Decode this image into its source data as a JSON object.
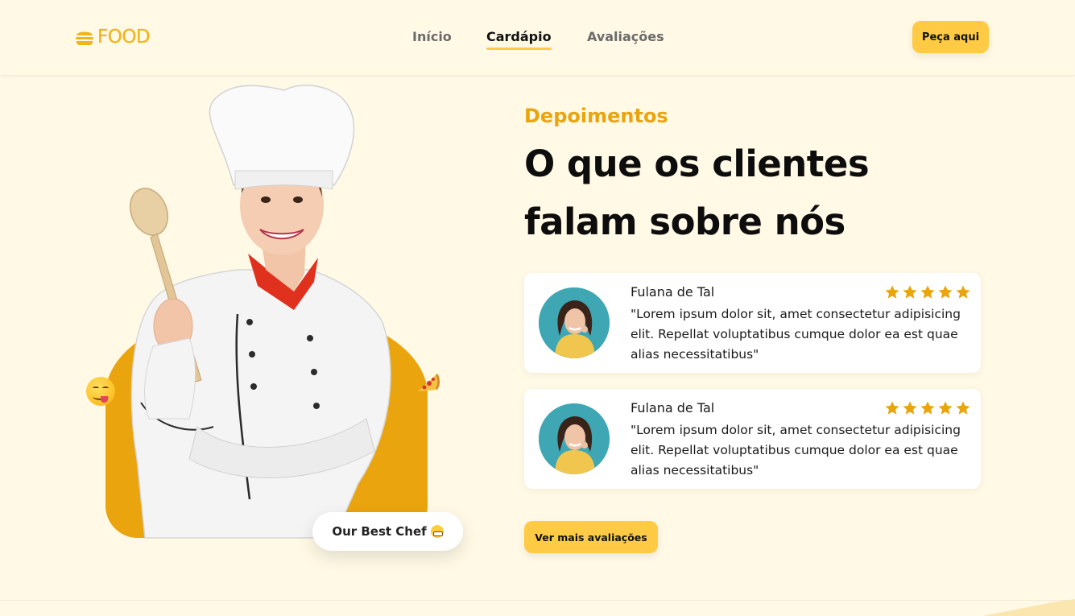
{
  "brand": {
    "logo_text": "FOOD",
    "accent": "#ffcb45",
    "accent_dark": "#eaa40d",
    "background": "#fff9e6"
  },
  "nav": {
    "items": [
      {
        "label": "Início",
        "active": false
      },
      {
        "label": "Cardápio",
        "active": true
      },
      {
        "label": "Avaliações",
        "active": false
      }
    ],
    "cta_label": "Peça aqui"
  },
  "hero": {
    "chef_tag_label": "Our Best Chef"
  },
  "testimonials": {
    "kicker": "Depoimentos",
    "title_line1": "O que os clientes",
    "title_line2": "falam sobre nós",
    "reviews": [
      {
        "name": "Fulana de Tal",
        "rating": 5,
        "text": "\"Lorem ipsum dolor sit, amet consectetur adipisicing elit. Repellat voluptatibus cumque dolor ea est quae alias necessitatibus\""
      },
      {
        "name": "Fulana de Tal",
        "rating": 5,
        "text": "\"Lorem ipsum dolor sit, amet consectetur adipisicing elit. Repellat voluptatibus cumque dolor ea est quae alias necessitatibus\""
      }
    ],
    "more_label": "Ver mais avaliações"
  }
}
